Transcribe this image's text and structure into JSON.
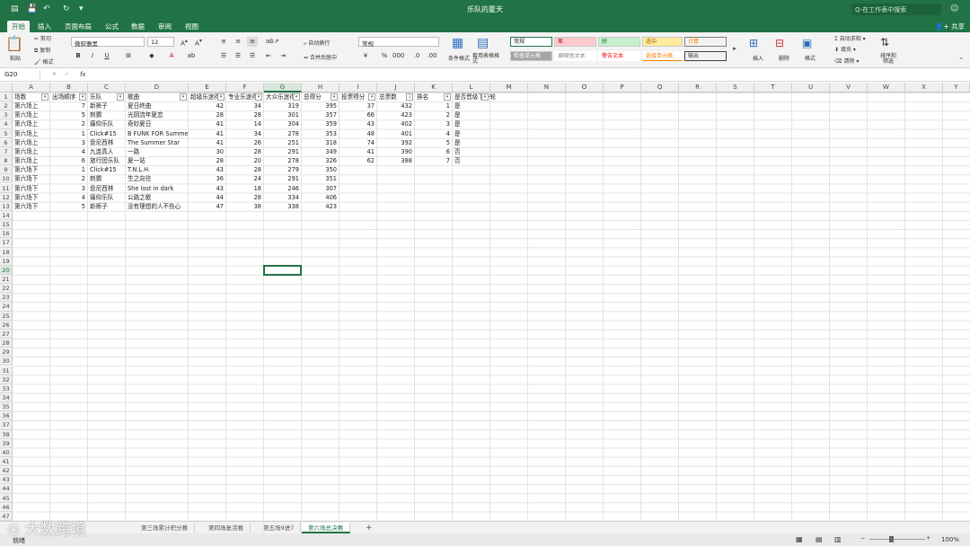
{
  "window": {
    "title": "乐队的夏天",
    "search_placeholder": "Q-在工作表中搜索"
  },
  "menu": {
    "tabs": [
      "开始",
      "插入",
      "页面布局",
      "公式",
      "数据",
      "审阅",
      "视图"
    ],
    "active_tab": "开始",
    "share": "共享"
  },
  "ribbon": {
    "paste": "粘贴",
    "cut": "剪切",
    "copy": "复制",
    "format_painter": "格式",
    "font_name": "微软雅黑",
    "font_size": "12",
    "wrap_text": "自动换行",
    "merge_center": "合并后居中",
    "number_format": "常规",
    "conditional_format": "条件格式",
    "format_table": "套用表格格式",
    "styles": [
      "常规",
      "差",
      "好",
      "适中",
      "计算",
      "检查单元格",
      "解释性文本",
      "警告文本",
      "链接单元格",
      "输出"
    ],
    "insert": "插入",
    "delete": "删除",
    "format": "格式",
    "autosum": "自动求和",
    "fill": "填充",
    "clear": "清除",
    "sort_filter": "排序和筛选"
  },
  "formula": {
    "name_box": "G20",
    "fx": "fx",
    "content": ""
  },
  "columns": [
    "A",
    "B",
    "C",
    "D",
    "E",
    "F",
    "G",
    "H",
    "I",
    "J",
    "K",
    "L",
    "M",
    "N",
    "O",
    "P",
    "Q",
    "R",
    "S",
    "T",
    "U",
    "V",
    "W",
    "X",
    "Y"
  ],
  "active_column": "G",
  "active_row": 20,
  "headers": [
    "场数",
    "出场顺序",
    "乐队",
    "歌曲",
    "超级乐迷得",
    "专业乐迷得",
    "大众乐迷得",
    "总得分",
    "投票得分",
    "总票数",
    "排名",
    "是否晋级下一轮"
  ],
  "rows": [
    [
      "第六场上",
      "7",
      "新裤子",
      "夏日终曲",
      "42",
      "34",
      "319",
      "395",
      "37",
      "432",
      "1",
      "是"
    ],
    [
      "第六场上",
      "5",
      "刺猬",
      "光阴流年夏恋",
      "28",
      "28",
      "301",
      "357",
      "66",
      "423",
      "2",
      "是"
    ],
    [
      "第六场上",
      "2",
      "痛仰乐队",
      "奇妙夏日",
      "41",
      "14",
      "304",
      "359",
      "43",
      "402",
      "3",
      "是"
    ],
    [
      "第六场上",
      "1",
      "Click#15",
      "B FUNK FOR Summer",
      "41",
      "34",
      "278",
      "353",
      "48",
      "401",
      "4",
      "是"
    ],
    [
      "第六场上",
      "3",
      "盘尼西林",
      "The Summer Star",
      "41",
      "26",
      "251",
      "318",
      "74",
      "392",
      "5",
      "是"
    ],
    [
      "第六场上",
      "4",
      "九连真人",
      "一路",
      "30",
      "28",
      "291",
      "349",
      "41",
      "390",
      "6",
      "否"
    ],
    [
      "第六场上",
      "6",
      "旅行团乐队",
      "夏一站",
      "28",
      "20",
      "278",
      "326",
      "62",
      "388",
      "7",
      "否"
    ],
    [
      "第六场下",
      "1",
      "Click#15",
      "T.N.L.H.",
      "43",
      "28",
      "279",
      "350",
      "",
      "",
      "",
      ""
    ],
    [
      "第六场下",
      "2",
      "刺猬",
      "生之向往",
      "36",
      "24",
      "291",
      "351",
      "",
      "",
      "",
      ""
    ],
    [
      "第六场下",
      "3",
      "盘尼西林",
      "She lost in dark",
      "43",
      "18",
      "246",
      "307",
      "",
      "",
      "",
      ""
    ],
    [
      "第六场下",
      "4",
      "痛仰乐队",
      "公路之歌",
      "44",
      "28",
      "334",
      "406",
      "",
      "",
      "",
      ""
    ],
    [
      "第六场下",
      "5",
      "新裤子",
      "没有理想的人不伤心",
      "47",
      "38",
      "338",
      "423",
      "",
      "",
      "",
      ""
    ]
  ],
  "sheets": [
    "第三场累计积分赛",
    "第四场复活赛",
    "第五场9进7",
    "第六场总决赛"
  ],
  "active_sheet": "第六场总决赛",
  "status": {
    "mode": "就绪",
    "zoom": "100%"
  },
  "watermark": "大数跨境",
  "colors": {
    "accent": "#217346"
  }
}
